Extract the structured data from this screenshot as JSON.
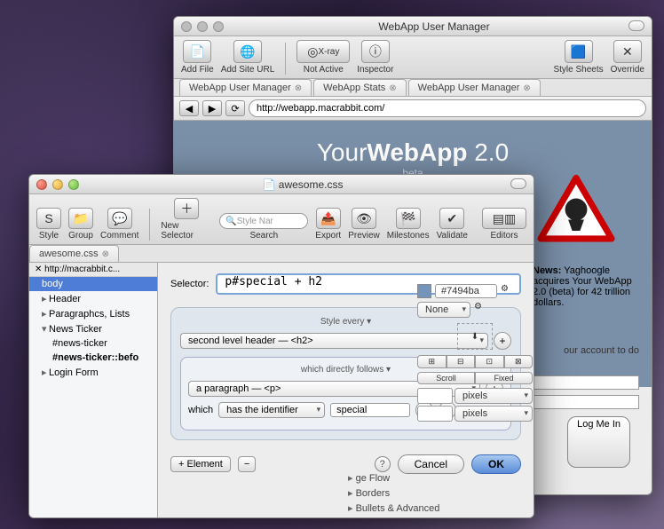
{
  "back_window": {
    "title": "WebApp User Manager",
    "toolbar": {
      "add_file": "Add File",
      "add_url": "Add Site URL",
      "xray": "X-ray",
      "not_active": "Not Active",
      "inspector": "Inspector",
      "style_sheets": "Style Sheets",
      "override": "Override"
    },
    "tabs": [
      "WebApp User Manager",
      "WebApp Stats",
      "WebApp User Manager"
    ],
    "url": "http://webapp.macrabbit.com/",
    "page": {
      "logo_pre": "Your",
      "logo_main": "WebApp",
      "logo_ver": "2.0",
      "beta": "beta",
      "news_label": "News:",
      "news_body": "Yaghoogle acquires Your WebApp 2.0 (beta) for 42 trillion dollars.",
      "account_hint": "our account to do",
      "login": "Log Me In"
    },
    "right_panel": {
      "color_hex": "#7494ba",
      "none": "None",
      "scroll": "Scroll",
      "fixed": "Fixed",
      "pixels": "pixels",
      "page_flow": "ge Flow",
      "borders": "Borders",
      "bullets": "Bullets & Advanced"
    }
  },
  "front_window": {
    "title": "awesome.css",
    "toolbar": {
      "style": "Style",
      "group": "Group",
      "comment": "Comment",
      "new_selector": "New Selector",
      "search_placeholder": "Style Nar",
      "search": "Search",
      "export": "Export",
      "preview": "Preview",
      "milestones": "Milestones",
      "validate": "Validate",
      "editors": "Editors"
    },
    "sidebar": {
      "tab": "awesome.css",
      "url": "http://macrabbit.c...",
      "items": [
        {
          "label": "body",
          "selected": true
        },
        {
          "label": "Header",
          "tri": "▸"
        },
        {
          "label": "Paragraphcs, Lists",
          "tri": "▸"
        },
        {
          "label": "News Ticker",
          "tri": "▾"
        },
        {
          "label": "#news-ticker",
          "indent": true
        },
        {
          "label": "#news-ticker::befo",
          "indent": true,
          "bold": true
        },
        {
          "label": "Login Form",
          "tri": "▸"
        }
      ]
    },
    "inspector": {
      "selector_label": "Selector:",
      "selector_value": "p#special + h2",
      "style_every": "Style every",
      "h2_option": "second level header — <h2>",
      "follows_label": "which directly follows",
      "p_option": "a paragraph — <p>",
      "which": "which",
      "has_identifier": "has the identifier",
      "identifier_value": "special",
      "element_btn": "+ Element",
      "cancel": "Cancel",
      "ok": "OK"
    }
  }
}
